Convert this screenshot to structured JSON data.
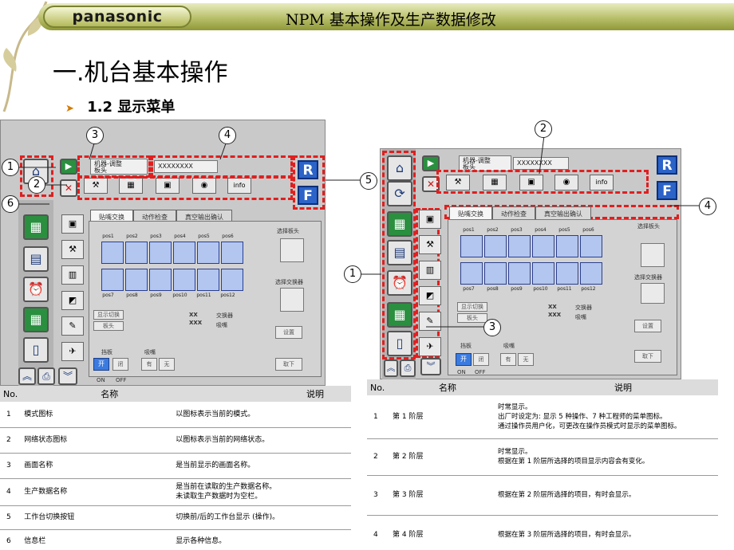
{
  "header": {
    "brand": "panasonic",
    "title": "NPM 基本操作及生产数据修改"
  },
  "section_title": "一.机台基本操作",
  "subsection": {
    "bullet": "➤",
    "label": "1.2 显示菜单"
  },
  "left_screen": {
    "screen_name": "机器-调整\n板头",
    "data_name": "XXXXXXXX",
    "right_buttons": [
      "R",
      "F"
    ],
    "tabs": [
      "贴嘴交换",
      "动作检查",
      "真空输出确认"
    ],
    "pos_top": [
      "pos1",
      "pos2",
      "pos3",
      "pos4",
      "pos5",
      "pos6"
    ],
    "pos_bottom": [
      "pos7",
      "pos8",
      "pos9",
      "pos10",
      "pos11",
      "pos12"
    ],
    "select_head": "选择板头",
    "select_changer": "选择交换器",
    "display_switch": "显示切换",
    "display_value": "板头",
    "legend_xx": "XX",
    "legend_xxx": "XXX",
    "legend_changer": "交换器",
    "legend_nozzle": "吸嘴",
    "settings_btn": "设置",
    "remove_btn": "取下",
    "stopper_label": "挡板",
    "stopper_open": "开",
    "stopper_close": "闭",
    "nozzle_label": "吸嘴",
    "nozzle_have": "有",
    "nozzle_none": "无",
    "on_label": "ON",
    "off_label": "OFF"
  },
  "right_screen": {
    "screen_name": "机器-调整\n板头",
    "data_name": "XXXXXXXX",
    "right_buttons": [
      "R",
      "F"
    ],
    "tabs": [
      "贴嘴交换",
      "动作检查",
      "真空输出确认"
    ],
    "pos_top": [
      "pos1",
      "pos2",
      "pos3",
      "pos4",
      "pos5",
      "pos6"
    ],
    "pos_bottom": [
      "pos7",
      "pos8",
      "pos9",
      "pos10",
      "pos11",
      "pos12"
    ],
    "select_head": "选择板头",
    "select_changer": "选择交换器",
    "display_switch": "显示切换",
    "display_value": "板头",
    "legend_xx": "XX",
    "legend_xxx": "XXX",
    "legend_changer": "交换器",
    "legend_nozzle": "吸嘴",
    "settings_btn": "设置",
    "remove_btn": "取下",
    "stopper_label": "挡板",
    "stopper_open": "开",
    "stopper_close": "闭",
    "nozzle_label": "吸嘴",
    "nozzle_have": "有",
    "nozzle_none": "无",
    "on_label": "ON",
    "off_label": "OFF"
  },
  "callouts_left": [
    "1",
    "2",
    "3",
    "4",
    "5",
    "6"
  ],
  "callouts_right": [
    "1",
    "2",
    "3",
    "4"
  ],
  "left_table": {
    "headers": [
      "No.",
      "名称",
      "说明"
    ],
    "rows": [
      [
        "1",
        "模式图标",
        "以图标表示当前的模式。"
      ],
      [
        "2",
        "网络状态图标",
        "以图标表示当前的网络状态。"
      ],
      [
        "3",
        "画面名称",
        "是当前显示的画面名称。"
      ],
      [
        "4",
        "生产数据名称",
        "是当前在读取的生产数据名称。\n未读取生产数据时为空栏。"
      ],
      [
        "5",
        "工作台切换按钮",
        "切换前/后的工作台显示 (操作)。"
      ],
      [
        "6",
        "信息栏",
        "显示各种信息。"
      ]
    ]
  },
  "right_table": {
    "headers": [
      "No.",
      "名称",
      "说明"
    ],
    "rows": [
      [
        "1",
        "第 1 阶层",
        "时常显示。\n出厂时设定为: 显示 5 种操作、7 种工程师的菜单图标。\n通过操作员用户化，可更改在操作员模式时显示的菜单图标。"
      ],
      [
        "2",
        "第 2 阶层",
        "时常显示。\n根据在第 1 阶层所选择的项目显示内容会有变化。"
      ],
      [
        "3",
        "第 3 阶层",
        "根据在第 2 阶层所选择的项目，有时会显示。"
      ],
      [
        "4",
        "第 4 阶层",
        "根据在第 3 阶层所选择的项目，有时会显示。"
      ]
    ]
  }
}
